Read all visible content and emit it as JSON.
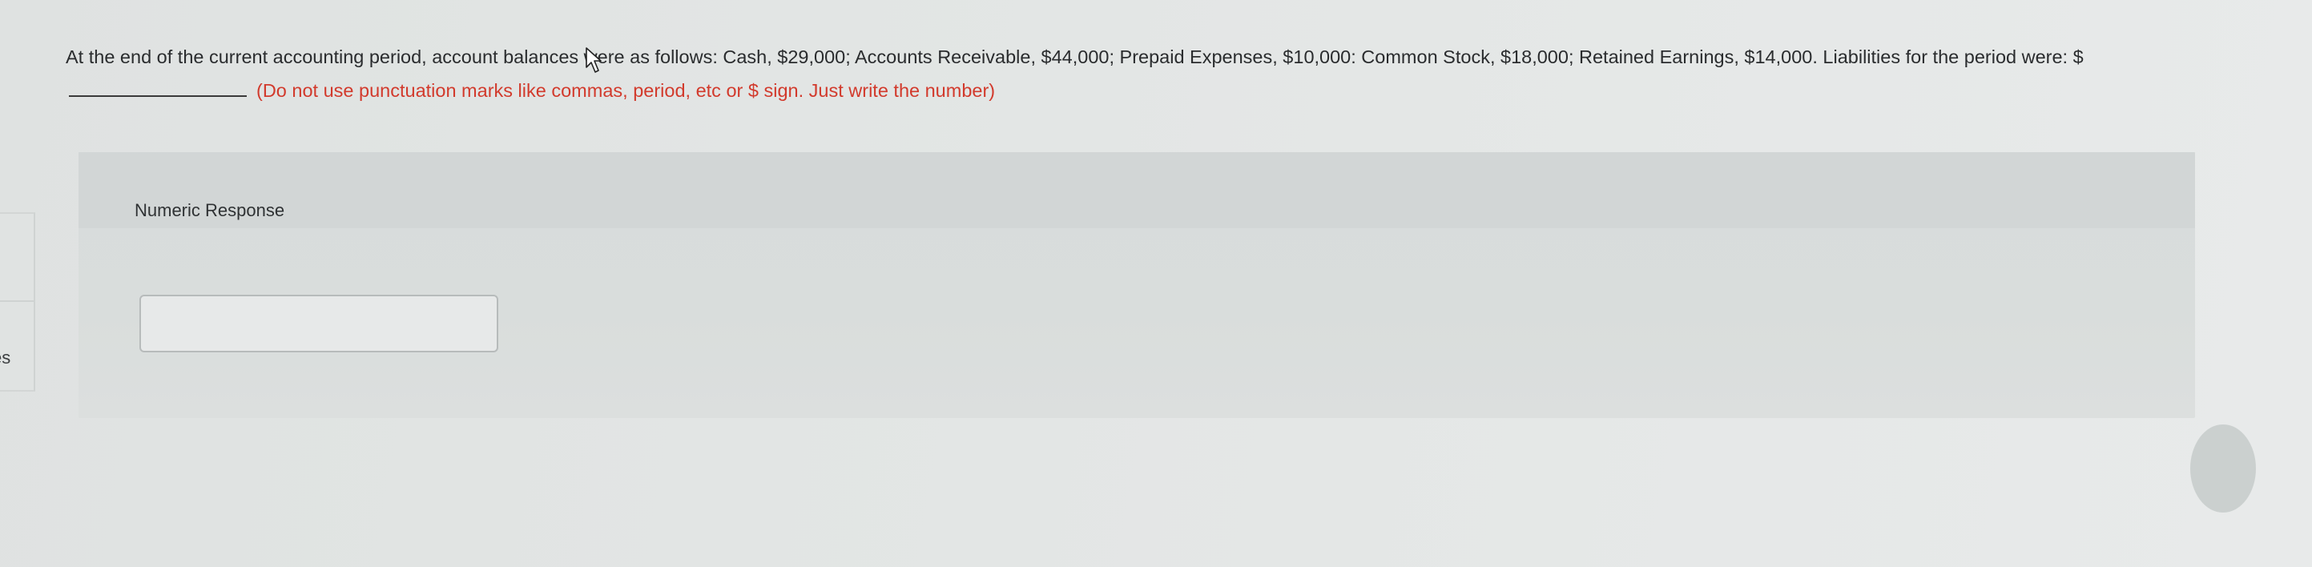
{
  "question": {
    "text": "At the end of the current accounting period, account balances were as follows: Cash, $29,000; Accounts Receivable, $44,000; Prepaid Expenses, $10,000: Common Stock, $18,000; Retained Earnings, $14,000. Liabilities for the period were: $",
    "instruction": "(Do not use punctuation marks like commas, period, etc or $ sign. Just write the number)"
  },
  "response": {
    "label": "Numeric Response",
    "value": ""
  },
  "sidebar": {
    "partial_label": "es"
  }
}
